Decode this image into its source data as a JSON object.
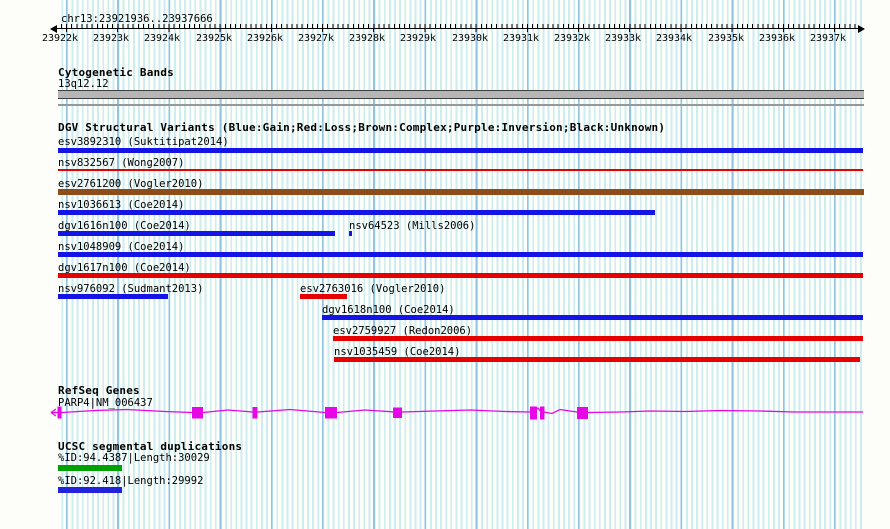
{
  "region": {
    "title": "chr13:23921936..23937666"
  },
  "axis": {
    "ticks": [
      "23922k",
      "23923k",
      "23924k",
      "23925k",
      "23926k",
      "23927k",
      "23928k",
      "23929k",
      "23930k",
      "23931k",
      "23932k",
      "23933k",
      "23934k",
      "23935k",
      "23936k",
      "23937k"
    ]
  },
  "cytobands": {
    "header": "Cytogenetic Bands",
    "band_label": "13q12.12"
  },
  "dgv": {
    "header": "DGV Structural Variants (Blue:Gain;Red:Loss;Brown:Complex;Purple:Inversion;Black:Unknown)",
    "variants": [
      {
        "label": "esv3892310 (Suktitipat2014)",
        "type": "gain"
      },
      {
        "label": "nsv832567 (Wong2007)",
        "type": "loss"
      },
      {
        "label": "esv2761200 (Vogler2010)",
        "type": "complex"
      },
      {
        "label": "nsv1036613 (Coe2014)",
        "type": "gain"
      },
      {
        "label": "dgv1616n100 (Coe2014)",
        "type": "gain"
      },
      {
        "label": "nsv64523 (Mills2006)",
        "type": "gain"
      },
      {
        "label": "nsv1048909 (Coe2014)",
        "type": "gain"
      },
      {
        "label": "dgv1617n100 (Coe2014)",
        "type": "loss"
      },
      {
        "label": "nsv976092 (Sudmant2013)",
        "type": "gain"
      },
      {
        "label": "esv2763016 (Vogler2010)",
        "type": "loss"
      },
      {
        "label": "dgv1618n100 (Coe2014)",
        "type": "gain"
      },
      {
        "label": "esv2759927 (Redon2006)",
        "type": "loss"
      },
      {
        "label": "nsv1035459 (Coe2014)",
        "type": "loss"
      }
    ]
  },
  "refseq": {
    "header": "RefSeq Genes",
    "gene_label": "PARP4|NM_006437"
  },
  "segdup": {
    "header": "UCSC segmental duplications",
    "items": [
      {
        "label": "%ID:94.4387|Length:30029"
      },
      {
        "label": "%ID:92.418|Length:29992"
      }
    ]
  },
  "colors": {
    "gain_blue": "#1414e6",
    "loss_red": "#e60000",
    "complex_brown": "#8e4c19",
    "gene_magenta": "#e606e6",
    "segdup_green": "#00a000",
    "segdup_blue": "#2222dd",
    "band_gray": "#b6b6b6",
    "grid_minor": "#cdedf0",
    "grid_major": "#8fc5e7"
  }
}
